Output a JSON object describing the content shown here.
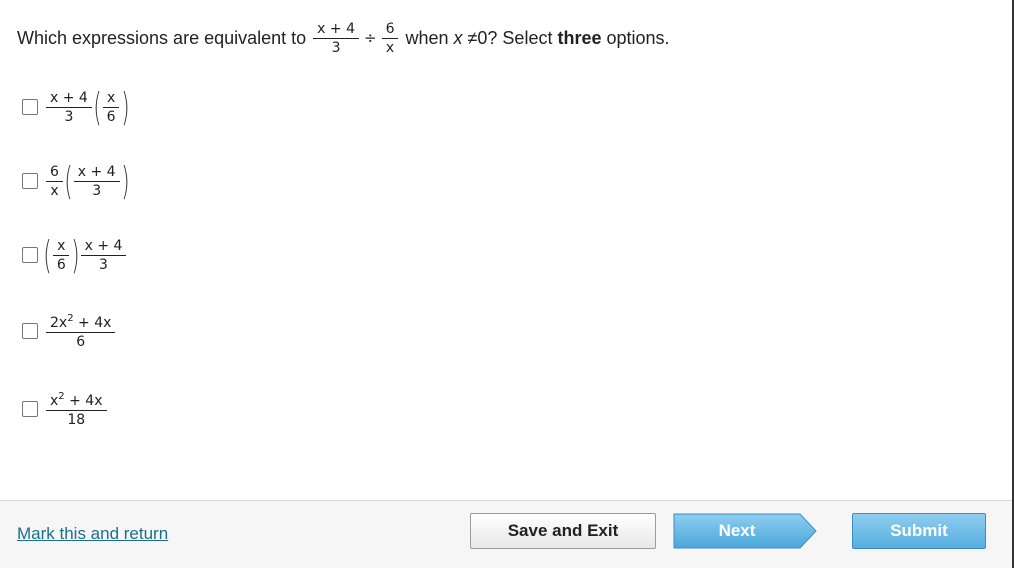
{
  "question": {
    "prefix": "Which expressions are equivalent to",
    "expr_num": "x + 4",
    "expr_den": "3",
    "divide": "÷",
    "expr2_num": "6",
    "expr2_den": "x",
    "when": "when",
    "var": "x",
    "neq": "≠",
    "cond": "0? Select",
    "emph": "three",
    "suffix": "options."
  },
  "options": [
    {
      "checked": false,
      "a_num": "x + 4",
      "a_den": "3",
      "b_num": "x",
      "b_den": "6"
    },
    {
      "checked": false,
      "a_num": "6",
      "a_den": "x",
      "b_num": "x + 4",
      "b_den": "3"
    },
    {
      "checked": false,
      "a_num": "x",
      "a_den": "6",
      "b_num": "x + 4",
      "b_den": "3"
    },
    {
      "checked": false,
      "num_coef": "2x",
      "num_exp": "2",
      "num_rest": "+ 4x",
      "den": "6"
    },
    {
      "checked": false,
      "num_coef": "x",
      "num_exp": "2",
      "num_rest": "+ 4x",
      "den": "18"
    }
  ],
  "footer": {
    "mark_label": "Mark this and return",
    "save_label": "Save and Exit",
    "next_label": "Next",
    "submit_label": "Submit"
  },
  "colors": {
    "link": "#1a6f8c",
    "next_bg": "#5fb4e2",
    "submit_bg": "#6bbde8"
  }
}
